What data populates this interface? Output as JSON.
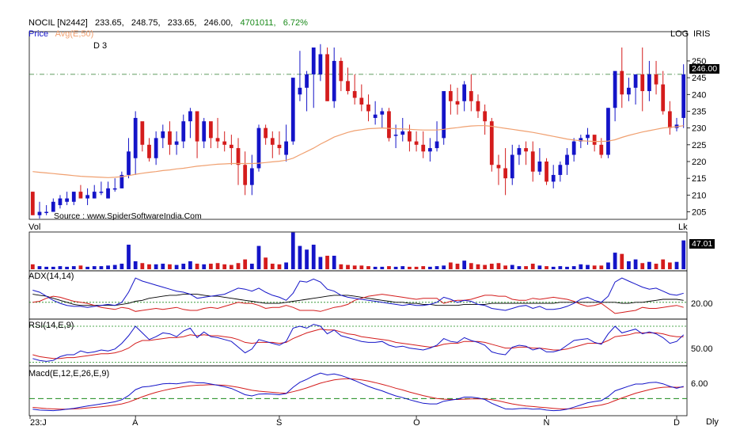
{
  "header": {
    "symbol": "NOCIL [N2442]",
    "open": "233.65,",
    "high": "248.75,",
    "low": "233.65,",
    "close": "246.00,",
    "volume": "4701011,",
    "change": "6.72%",
    "price_label": "Price",
    "avg_label": "Avg(E,50)",
    "d_label": "D 3",
    "scale_mode": "LOG",
    "exchange": "IRIS",
    "source": "Source : www.SpiderSoftwareIndia.Com"
  },
  "panels": {
    "vol": {
      "label": "Vol",
      "unit": "Lk",
      "last": "47.01"
    },
    "adx": {
      "label": "ADX(14,14)",
      "level": "20.00"
    },
    "rsi": {
      "label": "RSI(14,E,9)",
      "level": "50.00"
    },
    "macd": {
      "label": "Macd(E,12,E,26,E,9)",
      "level": "6.00"
    }
  },
  "colors": {
    "up": "#1414c8",
    "down": "#d41c1c",
    "avg": "#f0a070",
    "accent_green": "#1a8a1a"
  },
  "x_axis": {
    "labels": [
      "23:J",
      "A",
      "S",
      "O",
      "N",
      "D"
    ],
    "period": "Dly"
  },
  "chart_data": {
    "type": "candlestick",
    "y_ticks": [
      205,
      210,
      215,
      220,
      225,
      230,
      235,
      240,
      245,
      250
    ],
    "last_price": "246.00",
    "reference_level": 246,
    "ohlc": [
      [
        211,
        211,
        204,
        204
      ],
      [
        204,
        208,
        203,
        205
      ],
      [
        205,
        207,
        204,
        205
      ],
      [
        205,
        209,
        205,
        208
      ],
      [
        207,
        210,
        206,
        209
      ],
      [
        208,
        211,
        207,
        209
      ],
      [
        208,
        211,
        207,
        211
      ],
      [
        211,
        213,
        209,
        209
      ],
      [
        209,
        212,
        207,
        210
      ],
      [
        209,
        213,
        209,
        211
      ],
      [
        211,
        214,
        210,
        211
      ],
      [
        209,
        214,
        209,
        212
      ],
      [
        212,
        215,
        211,
        212
      ],
      [
        212,
        217,
        212,
        216
      ],
      [
        216,
        227,
        215,
        223
      ],
      [
        221,
        235,
        216,
        233
      ],
      [
        232,
        230,
        223,
        225
      ],
      [
        225,
        227,
        220,
        221
      ],
      [
        221,
        229,
        219,
        227
      ],
      [
        227,
        231,
        224,
        229
      ],
      [
        229,
        232,
        222,
        225
      ],
      [
        225,
        229,
        222,
        226
      ],
      [
        226,
        234,
        224,
        232
      ],
      [
        232,
        236,
        227,
        235
      ],
      [
        235,
        233,
        221,
        226
      ],
      [
        226,
        233,
        224,
        232
      ],
      [
        232,
        231,
        224,
        227
      ],
      [
        227,
        233,
        224,
        226
      ],
      [
        226,
        229,
        223,
        225
      ],
      [
        225,
        228,
        219,
        224
      ],
      [
        224,
        227,
        213,
        219
      ],
      [
        219,
        223,
        210,
        213
      ],
      [
        213,
        222,
        210,
        218
      ],
      [
        218,
        231,
        217,
        230
      ],
      [
        230,
        231,
        225,
        227
      ],
      [
        227,
        229,
        221,
        225
      ],
      [
        225,
        229,
        222,
        224
      ],
      [
        222,
        231,
        220,
        226
      ],
      [
        226,
        241,
        225,
        245
      ],
      [
        240,
        253,
        238,
        242
      ],
      [
        242,
        247,
        235,
        246
      ],
      [
        246,
        254,
        236,
        254
      ],
      [
        246,
        255,
        244,
        252
      ],
      [
        252,
        254,
        238,
        238
      ],
      [
        238,
        254,
        236,
        250
      ],
      [
        250,
        251,
        241,
        244
      ],
      [
        244,
        248,
        240,
        241
      ],
      [
        241,
        246,
        237,
        239
      ],
      [
        239,
        243,
        235,
        237
      ],
      [
        237,
        240,
        232,
        235
      ],
      [
        233,
        238,
        231,
        234
      ],
      [
        234,
        236,
        230,
        235
      ],
      [
        235,
        236,
        226,
        227
      ],
      [
        228,
        231,
        224,
        228
      ],
      [
        228,
        233,
        226,
        229
      ],
      [
        229,
        231,
        223,
        226
      ],
      [
        226,
        229,
        223,
        225
      ],
      [
        225,
        229,
        221,
        223
      ],
      [
        223,
        227,
        220,
        224
      ],
      [
        224,
        232,
        223,
        226
      ],
      [
        227,
        238,
        225,
        241
      ],
      [
        241,
        243,
        234,
        238
      ],
      [
        238,
        242,
        234,
        237
      ],
      [
        238,
        244,
        235,
        243
      ],
      [
        241,
        246,
        235,
        238
      ],
      [
        238,
        240,
        233,
        235
      ],
      [
        235,
        237,
        228,
        232
      ],
      [
        232,
        233,
        217,
        219
      ],
      [
        219,
        222,
        213,
        218
      ],
      [
        218,
        224,
        210,
        215
      ],
      [
        215,
        225,
        213,
        222
      ],
      [
        222,
        225,
        219,
        224
      ],
      [
        224,
        226,
        219,
        223
      ],
      [
        223,
        226,
        214,
        217
      ],
      [
        217,
        224,
        216,
        220
      ],
      [
        220,
        221,
        213,
        214
      ],
      [
        214,
        219,
        212,
        216
      ],
      [
        216,
        220,
        214,
        219
      ],
      [
        219,
        224,
        216,
        222
      ],
      [
        222,
        227,
        220,
        226
      ],
      [
        226,
        228,
        224,
        227
      ],
      [
        227,
        230,
        225,
        228
      ],
      [
        228,
        226,
        223,
        225
      ],
      [
        225,
        227,
        221,
        222
      ],
      [
        222,
        236,
        221,
        236
      ],
      [
        236,
        246,
        232,
        247
      ],
      [
        247,
        254,
        236,
        240
      ],
      [
        240,
        245,
        238,
        242
      ],
      [
        242,
        246,
        237,
        246
      ],
      [
        246,
        254,
        235,
        241
      ],
      [
        241,
        250,
        238,
        246
      ],
      [
        246,
        250,
        240,
        243
      ],
      [
        243,
        247,
        234,
        235
      ],
      [
        235,
        238,
        228,
        230
      ],
      [
        230,
        233,
        229,
        231
      ],
      [
        233,
        249,
        230,
        246
      ]
    ],
    "avg_e50": [
      217.0,
      216.8,
      216.6,
      216.4,
      216.2,
      216.0,
      215.8,
      215.6,
      215.5,
      215.4,
      215.3,
      215.2,
      215.3,
      215.5,
      215.8,
      216.2,
      216.5,
      216.8,
      217.0,
      217.3,
      217.5,
      217.8,
      218.0,
      218.3,
      218.6,
      218.8,
      219.0,
      219.2,
      219.3,
      219.4,
      219.4,
      219.4,
      219.4,
      219.5,
      219.7,
      219.9,
      220.1,
      220.4,
      221.0,
      222.0,
      223.0,
      224.0,
      225.2,
      226.2,
      227.3,
      228.0,
      228.7,
      229.2,
      229.5,
      229.8,
      229.9,
      230.0,
      229.9,
      229.8,
      229.7,
      229.6,
      229.5,
      229.4,
      229.4,
      229.4,
      229.6,
      229.9,
      230.1,
      230.4,
      230.6,
      230.7,
      230.7,
      230.5,
      230.2,
      229.9,
      229.6,
      229.3,
      229.0,
      228.7,
      228.3,
      227.9,
      227.5,
      227.1,
      226.7,
      226.4,
      226.2,
      226.1,
      226.0,
      226.0,
      226.1,
      226.5,
      227.2,
      227.8,
      228.3,
      228.8,
      229.2,
      229.6,
      230.0,
      230.2,
      230.4,
      230.7
    ],
    "volume": [
      8,
      5,
      4,
      4,
      5,
      4,
      5,
      6,
      4,
      5,
      5,
      6,
      7,
      9,
      40,
      13,
      10,
      8,
      8,
      9,
      8,
      7,
      9,
      13,
      9,
      8,
      9,
      10,
      8,
      7,
      10,
      16,
      9,
      38,
      19,
      9,
      8,
      11,
      60,
      38,
      32,
      40,
      20,
      22,
      22,
      8,
      7,
      6,
      6,
      5,
      4,
      4,
      5,
      4,
      5,
      4,
      4,
      5,
      4,
      5,
      6,
      11,
      9,
      14,
      10,
      8,
      7,
      9,
      10,
      6,
      7,
      5,
      5,
      9,
      6,
      5,
      4,
      5,
      4,
      5,
      8,
      7,
      6,
      6,
      11,
      27,
      25,
      13,
      16,
      10,
      12,
      9,
      16,
      11,
      12,
      47
    ],
    "adx_plus": [
      32,
      30,
      26,
      22,
      19,
      17,
      16,
      16,
      15,
      16,
      17,
      18,
      17,
      20,
      30,
      44,
      41,
      39,
      37,
      35,
      33,
      31,
      30,
      28,
      24,
      25,
      26,
      27,
      28,
      31,
      34,
      33,
      31,
      34,
      30,
      27,
      25,
      22,
      29,
      41,
      40,
      43,
      40,
      33,
      31,
      27,
      25,
      24,
      23,
      22,
      21,
      20,
      19,
      18,
      17,
      18,
      17,
      17,
      18,
      20,
      25,
      23,
      20,
      22,
      21,
      18,
      17,
      14,
      13,
      12,
      14,
      16,
      17,
      14,
      16,
      13,
      13,
      14,
      16,
      19,
      23,
      25,
      22,
      20,
      26,
      40,
      44,
      41,
      38,
      35,
      33,
      34,
      31,
      28,
      27,
      29
    ],
    "adx_minus": [
      20,
      21,
      24,
      26,
      25,
      23,
      21,
      20,
      19,
      17,
      15,
      14,
      13,
      15,
      14,
      11,
      12,
      13,
      14,
      13,
      14,
      15,
      13,
      12,
      12,
      14,
      15,
      14,
      16,
      18,
      20,
      19,
      19,
      17,
      14,
      15,
      15,
      17,
      15,
      12,
      12,
      12,
      11,
      13,
      15,
      16,
      18,
      22,
      24,
      26,
      27,
      28,
      27,
      26,
      25,
      24,
      23,
      24,
      24,
      24,
      19,
      21,
      22,
      22,
      23,
      25,
      27,
      27,
      26,
      26,
      23,
      22,
      22,
      24,
      23,
      24,
      25,
      24,
      23,
      21,
      18,
      16,
      17,
      19,
      14,
      9,
      10,
      11,
      12,
      15,
      14,
      14,
      15,
      16,
      17,
      15
    ],
    "adx_line": [
      28,
      27,
      26,
      24,
      22,
      20,
      18,
      17,
      17,
      17,
      17,
      17,
      17,
      18,
      19,
      21,
      22,
      24,
      25,
      26,
      27,
      27,
      28,
      28,
      28,
      27,
      26,
      26,
      25,
      24,
      23,
      22,
      21,
      20,
      19,
      19,
      19,
      20,
      21,
      22,
      23,
      24,
      25,
      26,
      27,
      27,
      27,
      26,
      25,
      24,
      23,
      22,
      21,
      20,
      20,
      19,
      19,
      18,
      18,
      17,
      17,
      17,
      17,
      18,
      18,
      18,
      18,
      19,
      19,
      19,
      19,
      19,
      19,
      19,
      19,
      19,
      19,
      20,
      20,
      20,
      20,
      20,
      20,
      20,
      20,
      20,
      19,
      19,
      20,
      20,
      21,
      22,
      23,
      23,
      23,
      22
    ],
    "rsi": [
      36,
      34,
      33,
      34,
      38,
      40,
      40,
      44,
      42,
      43,
      45,
      44,
      46,
      52,
      60,
      70,
      63,
      56,
      59,
      63,
      62,
      59,
      65,
      68,
      58,
      64,
      59,
      58,
      56,
      54,
      48,
      42,
      46,
      56,
      54,
      52,
      50,
      54,
      68,
      70,
      68,
      72,
      70,
      62,
      66,
      60,
      58,
      56,
      54,
      53,
      53,
      54,
      50,
      48,
      49,
      47,
      46,
      45,
      47,
      50,
      57,
      54,
      53,
      58,
      55,
      53,
      50,
      43,
      41,
      40,
      48,
      50,
      49,
      45,
      47,
      43,
      43,
      45,
      50,
      55,
      56,
      57,
      53,
      51,
      62,
      70,
      63,
      65,
      67,
      62,
      64,
      62,
      58,
      52,
      54,
      61
    ],
    "rsi_signal": [
      40,
      38,
      37,
      36,
      36,
      37,
      37,
      38,
      39,
      40,
      41,
      41,
      42,
      44,
      47,
      52,
      55,
      55,
      56,
      57,
      58,
      58,
      59,
      61,
      60,
      61,
      60,
      60,
      59,
      58,
      56,
      53,
      52,
      53,
      53,
      53,
      52,
      53,
      57,
      60,
      63,
      65,
      67,
      66,
      66,
      64,
      62,
      61,
      59,
      58,
      57,
      56,
      55,
      53,
      52,
      51,
      50,
      49,
      48,
      49,
      51,
      52,
      52,
      54,
      54,
      54,
      53,
      51,
      49,
      47,
      47,
      48,
      48,
      47,
      47,
      46,
      45,
      45,
      46,
      48,
      50,
      52,
      52,
      52,
      55,
      59,
      60,
      61,
      63,
      63,
      63,
      63,
      62,
      60,
      59,
      59
    ],
    "macd": [
      -3.6,
      -3.9,
      -4.0,
      -4.1,
      -3.9,
      -3.6,
      -3.3,
      -2.9,
      -2.5,
      -2.2,
      -1.8,
      -1.5,
      -1.1,
      -0.4,
      1.0,
      3.0,
      3.9,
      4.1,
      4.5,
      5.0,
      5.1,
      5.0,
      5.3,
      5.7,
      5.3,
      5.3,
      4.9,
      4.5,
      4.0,
      3.4,
      2.4,
      1.3,
      0.9,
      1.5,
      1.6,
      1.5,
      1.3,
      1.7,
      3.8,
      5.5,
      6.5,
      7.7,
      8.6,
      8.0,
      8.3,
      7.8,
      7.0,
      6.1,
      5.1,
      4.1,
      3.3,
      2.6,
      1.7,
      0.9,
      0.3,
      -0.4,
      -1.0,
      -1.6,
      -1.8,
      -1.8,
      -0.9,
      -0.5,
      -0.2,
      0.5,
      0.5,
      0.2,
      -0.3,
      -1.6,
      -2.6,
      -3.5,
      -3.6,
      -3.4,
      -3.3,
      -3.6,
      -3.5,
      -3.9,
      -4.1,
      -4.0,
      -3.6,
      -2.9,
      -2.2,
      -1.4,
      -1.0,
      -0.7,
      0.7,
      2.6,
      3.4,
      4.2,
      4.9,
      4.9,
      5.4,
      5.5,
      5.0,
      4.1,
      3.5,
      4.1
    ],
    "macd_signal": [
      -3.0,
      -3.2,
      -3.4,
      -3.5,
      -3.6,
      -3.6,
      -3.5,
      -3.4,
      -3.2,
      -3.0,
      -2.8,
      -2.5,
      -2.2,
      -1.8,
      -1.2,
      -0.3,
      0.6,
      1.4,
      2.1,
      2.7,
      3.2,
      3.6,
      4.0,
      4.3,
      4.5,
      4.6,
      4.7,
      4.6,
      4.5,
      4.2,
      3.8,
      3.3,
      2.8,
      2.5,
      2.3,
      2.1,
      1.9,
      1.8,
      2.3,
      2.9,
      3.6,
      4.4,
      5.2,
      5.8,
      6.3,
      6.6,
      6.7,
      6.6,
      6.3,
      5.9,
      5.4,
      4.8,
      4.2,
      3.5,
      2.9,
      2.2,
      1.6,
      1.0,
      0.5,
      0.0,
      -0.2,
      -0.3,
      -0.3,
      -0.2,
      -0.1,
      -0.1,
      -0.1,
      -0.4,
      -0.8,
      -1.3,
      -1.8,
      -2.2,
      -2.5,
      -2.7,
      -2.9,
      -3.1,
      -3.3,
      -3.5,
      -3.5,
      -3.4,
      -3.2,
      -2.9,
      -2.5,
      -2.2,
      -1.6,
      -0.7,
      0.2,
      1.0,
      1.8,
      2.4,
      3.0,
      3.5,
      3.8,
      3.9,
      3.8,
      3.9
    ]
  }
}
